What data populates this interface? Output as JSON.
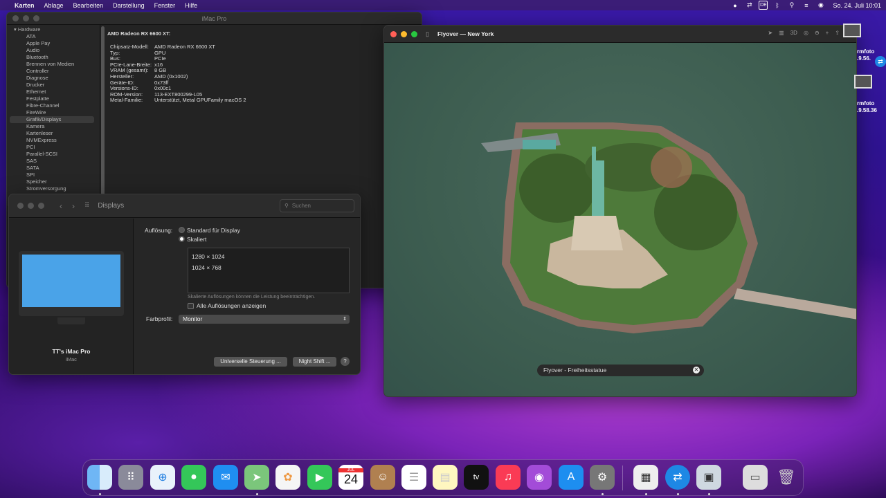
{
  "menubar": {
    "app": "Karten",
    "items": [
      "Ablage",
      "Bearbeiten",
      "Darstellung",
      "Fenster",
      "Hilfe"
    ],
    "keyboard": "DE",
    "datetime": "So. 24. Juli  10:01"
  },
  "sysinfo": {
    "title": "iMac Pro",
    "section": "Hardware",
    "items": [
      "ATA",
      "Apple Pay",
      "Audio",
      "Bluetooth",
      "Brennen von Medien",
      "Controller",
      "Diagnose",
      "Drucker",
      "Ethernet",
      "Festplatte",
      "Fibre-Channel",
      "FireWire",
      "Grafik/Displays",
      "Kamera",
      "Kartenleser",
      "NVMExpress",
      "PCI",
      "Parallel-SCSI",
      "SAS",
      "SATA",
      "SPI",
      "Speicher",
      "Stromversorgung"
    ],
    "selected": "Grafik/Displays",
    "heading": "AMD Radeon RX 6600 XT:",
    "rows": [
      [
        "Chipsatz-Modell:",
        "AMD Radeon RX 6600 XT"
      ],
      [
        "Typ:",
        "GPU"
      ],
      [
        "Bus:",
        "PCIe"
      ],
      [
        "PCIe-Lane-Breite:",
        "x16"
      ],
      [
        "VRAM (gesamt):",
        "8 GB"
      ],
      [
        "Hersteller:",
        "AMD (0x1002)"
      ],
      [
        "Geräte-ID:",
        "0x73ff"
      ],
      [
        "Versions-ID:",
        "0x00c1"
      ],
      [
        "ROM-Version:",
        "113-EXT800299-L05"
      ],
      [
        "Metal-Familie:",
        "Unterstützt, Metal GPUFamily macOS 2"
      ]
    ]
  },
  "displays": {
    "title": "Displays",
    "search_placeholder": "Suchen",
    "computer_name": "TT's iMac Pro",
    "computer_model": "iMac",
    "resolution_label": "Auflösung:",
    "option_default": "Standard für Display",
    "option_scaled": "Skaliert",
    "resolutions": [
      "1280 × 1024",
      "1024 × 768"
    ],
    "hint": "Skalierte Auflösungen können die Leistung beeinträchtigen.",
    "show_all": "Alle Auflösungen anzeigen",
    "profile_label": "Farbprofil:",
    "profile_value": "Monitor",
    "btn_universal": "Universelle Steuerung ...",
    "btn_nightshift": "Night Shift ...",
    "help": "?"
  },
  "flyover": {
    "title": "Flyover — New York",
    "caption": "Flyover - Freiheitsstatue",
    "tool_3d": "3D"
  },
  "desktop": {
    "label1a": "rmfoto",
    "label1b": ".9.56.",
    "label2a": "rmfoto",
    "label2b": ".9.58.36"
  },
  "dock": {
    "calendar_month": "JUL",
    "calendar_day": "24",
    "tv": "tv"
  }
}
